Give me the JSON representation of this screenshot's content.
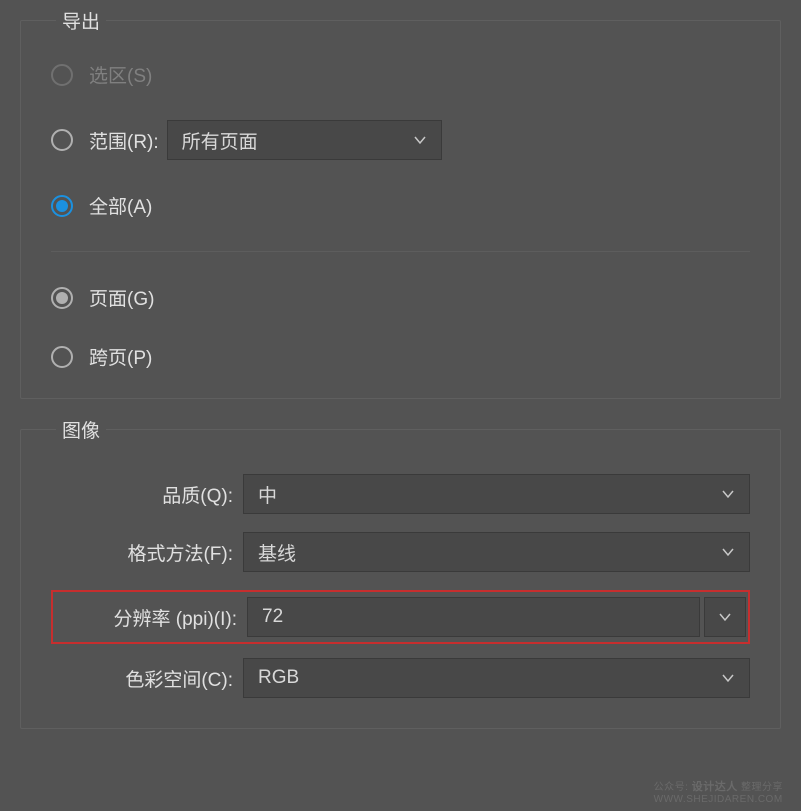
{
  "export": {
    "title": "导出",
    "options": {
      "selection": "选区(S)",
      "range": "范围(R):",
      "range_value": "所有页面",
      "all": "全部(A)",
      "page": "页面(G)",
      "spread": "跨页(P)"
    }
  },
  "image": {
    "title": "图像",
    "quality_label": "品质(Q):",
    "quality_value": "中",
    "format_label": "格式方法(F):",
    "format_value": "基线",
    "resolution_label": "分辨率 (ppi)(I):",
    "resolution_value": "72",
    "colorspace_label": "色彩空间(C):",
    "colorspace_value": "RGB"
  },
  "watermark": {
    "prefix": "公众号:",
    "name": "设计达人",
    "suffix": "整理分享",
    "url": "WWW.SHEJIDAREN.COM"
  }
}
